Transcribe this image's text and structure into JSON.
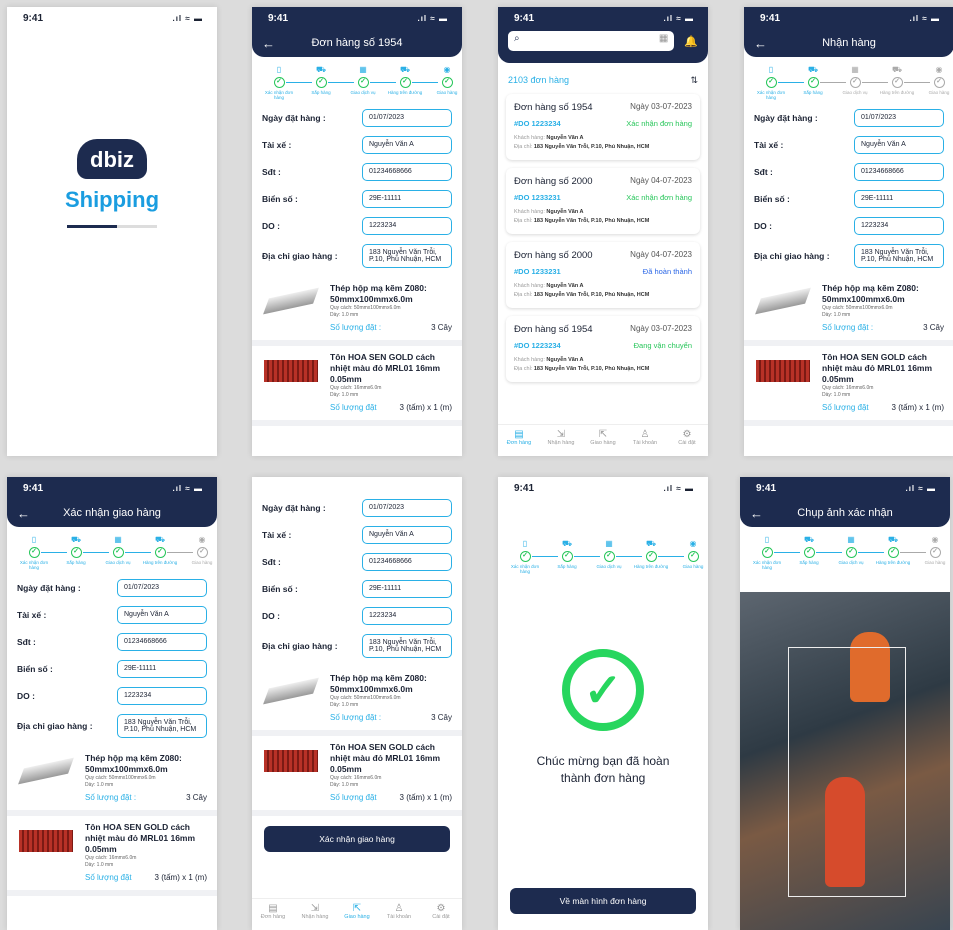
{
  "status": {
    "time": "9:41",
    "signal": ".ıl ≈ ▬"
  },
  "splash": {
    "logo_top": "dbiz",
    "logo_bottom": "Shipping"
  },
  "stepper": [
    {
      "label": "Xác nhận đơn hàng",
      "icon": "clipboard"
    },
    {
      "label": "Sắp hàng",
      "icon": "cart"
    },
    {
      "label": "Giao dịch vụ",
      "icon": "building"
    },
    {
      "label": "Hàng trên đường",
      "icon": "truck"
    },
    {
      "label": "Giao hàng",
      "icon": "pin"
    }
  ],
  "form": {
    "labels": {
      "date": "Ngày đặt hàng :",
      "driver": "Tài xế :",
      "phone": "Sđt :",
      "plate": "Biển số :",
      "do": "DO :",
      "addr": "Địa chỉ giao hàng :"
    },
    "values": {
      "date": "01/07/2023",
      "driver": "Nguyễn Văn A",
      "phone": "01234668666",
      "plate": "29E-11111",
      "do": "1223234",
      "addr": "183 Nguyễn Văn Trỗi, P.10, Phú Nhuận, HCM"
    }
  },
  "products": [
    {
      "name": "Thép hộp mạ kẽm Z080: 50mmx100mmx6.0m",
      "spec": "Quy cách: 50mmx100mmx6.0m",
      "thick": "Dày: 1.0 mm",
      "qty_label": "Số lượng đặt :",
      "qty": "3 Cây"
    },
    {
      "name": "Tôn HOA SEN GOLD cách nhiệt màu đỏ MRL01 16mm 0.05mm",
      "spec": "Quy cách: 16mmx6.0m",
      "thick": "Dày: 1.0 mm",
      "qty_label": "Số lượng đặt",
      "qty": "3 (tấm) x 1 (m)"
    }
  ],
  "screens": {
    "order_title": "Đơn hàng số 1954",
    "receive_title": "Nhận hàng",
    "confirm_title": "Xác nhận giao hàng",
    "photo_title": "Chụp ảnh xác nhận"
  },
  "list": {
    "count": "2103 đơn hàng",
    "orders": [
      {
        "title": "Đơn hàng số 1954",
        "date": "Ngày 03-07-2023",
        "code": "#DO 1223234",
        "status": "Xác nhận đơn hàng",
        "status_color": "#27c65a",
        "cust_label": "Khách hàng:",
        "cust": "Nguyễn Văn A",
        "addr_label": "Địa chỉ:",
        "addr": "183 Nguyễn Văn Trỗi, P.10, Phú Nhuận, HCM"
      },
      {
        "title": "Đơn hàng số 2000",
        "date": "Ngày 04-07-2023",
        "code": "#DO 1233231",
        "status": "Xác nhận đơn hàng",
        "status_color": "#27c65a",
        "cust_label": "Khách hàng:",
        "cust": "Nguyễn Văn A",
        "addr_label": "Địa chỉ:",
        "addr": "183 Nguyễn Văn Trỗi, P.10, Phú Nhuận, HCM"
      },
      {
        "title": "Đơn hàng số 2000",
        "date": "Ngày 04-07-2023",
        "code": "#DO 1233231",
        "status": "Đã hoàn thành",
        "status_color": "#2a66e6",
        "cust_label": "Khách hàng:",
        "cust": "Nguyễn Văn A",
        "addr_label": "Địa chỉ:",
        "addr": "183 Nguyễn Văn Trỗi, P.10, Phú Nhuận, HCM"
      },
      {
        "title": "Đơn hàng số 1954",
        "date": "Ngày 03-07-2023",
        "code": "#DO 1223234",
        "status": "Đang vận chuyển",
        "status_color": "#27c65a",
        "cust_label": "Khách hàng:",
        "cust": "Nguyễn Văn A",
        "addr_label": "Địa chỉ:",
        "addr": "183 Nguyễn Văn Trỗi, P.10, Phú Nhuận, HCM"
      }
    ]
  },
  "tabs": [
    "Đơn hàng",
    "Nhận hàng",
    "Giao hàng",
    "Tài khoản",
    "Cài đặt"
  ],
  "confirm_button": "Xác nhận giao hàng",
  "success": {
    "message": "Chúc mừng bạn đã hoàn thành đơn hàng",
    "button": "Về màn hình đơn hàng"
  }
}
